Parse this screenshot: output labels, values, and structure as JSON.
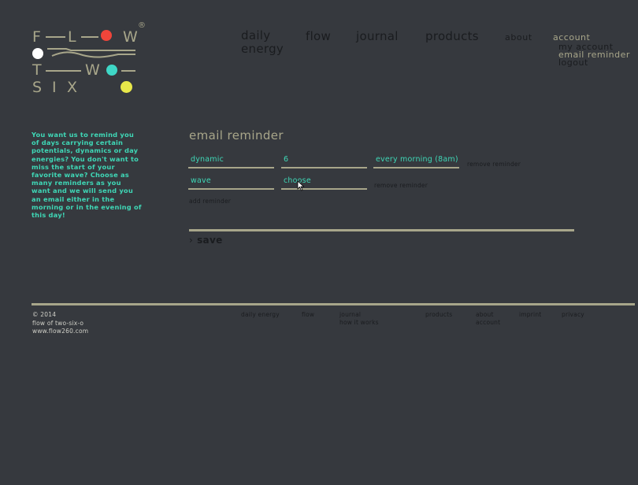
{
  "logo": {
    "row1": [
      "F",
      "L",
      "O",
      "W"
    ],
    "row3": [
      "T",
      "W",
      "O"
    ],
    "row4": [
      "S",
      "I",
      "X"
    ],
    "registered": "®",
    "colors": {
      "red": "#f0453a",
      "white": "#ffffff",
      "cyan": "#3fd7c6",
      "yellow": "#e8e84a",
      "ink": "#a8a68a"
    }
  },
  "nav": {
    "daily": "daily",
    "energy": "energy",
    "flow": "flow",
    "journal": "journal",
    "products": "products",
    "about": "about",
    "account": "account",
    "my_account": "my account",
    "email_reminder": "email reminder",
    "logout": "logout"
  },
  "intro": "You want us to remind you of days carrying certain potentials, dynamics or day energies? You don't want to miss the start of your favorite wave? Choose as many reminders as you want and we will send you an email either in the morning or in the evening of this day!",
  "form": {
    "heading": "email reminder",
    "row1": {
      "type": "dynamic",
      "value": "6",
      "time": "every morning (8am)",
      "remove": "remove reminder"
    },
    "row2": {
      "type": "wave",
      "value": "choose",
      "remove": "remove reminder"
    },
    "add": "add reminder",
    "save": "save",
    "chevron": "›"
  },
  "footer": {
    "copyright": "© 2014",
    "company": "flow of two-six-o",
    "url": "www.flow260.com",
    "daily_energy": "daily energy",
    "flow": "flow",
    "journal": "journal",
    "how_it_works": "how it works",
    "products": "products",
    "about": "about",
    "account": "account",
    "imprint": "imprint",
    "privacy": "privacy"
  },
  "accent": "#3fd7b6",
  "background": "#36393e"
}
